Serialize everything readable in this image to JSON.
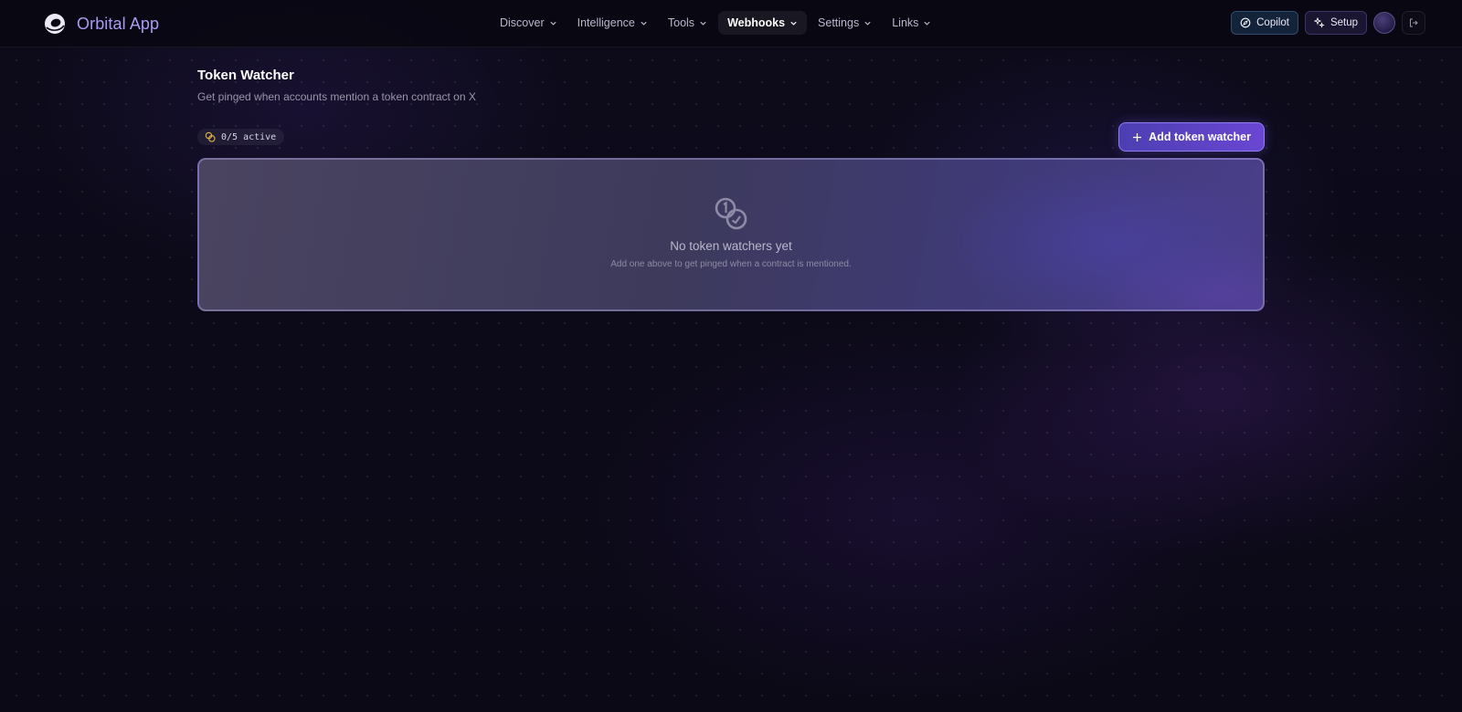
{
  "app": {
    "name": "Orbital App"
  },
  "nav": {
    "items": [
      {
        "label": "Discover",
        "active": false
      },
      {
        "label": "Intelligence",
        "active": false
      },
      {
        "label": "Tools",
        "active": false
      },
      {
        "label": "Webhooks",
        "active": true
      },
      {
        "label": "Settings",
        "active": false
      },
      {
        "label": "Links",
        "active": false
      }
    ]
  },
  "toolbar": {
    "copilot_label": "Copilot",
    "setup_label": "Setup"
  },
  "page": {
    "title": "Token Watcher",
    "subtitle": "Get pinged when accounts mention a token contract on X",
    "active_count": "0/5 active",
    "add_button_label": "Add token watcher"
  },
  "empty_state": {
    "title": "No token watchers yet",
    "subtitle": "Add one above to get pinged when a contract is mentioned."
  },
  "colors": {
    "accent": "#6a46d3",
    "brand": "#a99cf5",
    "copilot": "#13233a",
    "badge_icon": "#e0b44a"
  },
  "icons": [
    "orbital-logo-icon",
    "chevron-down-icon",
    "copilot-icon",
    "sparkle-icon",
    "logout-icon",
    "coins-icon",
    "plus-icon"
  ]
}
